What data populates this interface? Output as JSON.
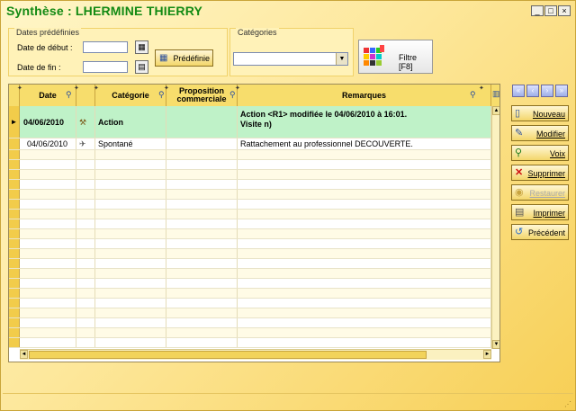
{
  "window": {
    "title": "Synthèse : LHERMINE THIERRY",
    "min_label": "_",
    "max_label": "□",
    "close_label": "×"
  },
  "dates": {
    "group_title": "Dates prédéfinies",
    "start_label": "Date de début :",
    "end_label": "Date de fin :",
    "start_value": "",
    "end_value": "",
    "predefined_label": "Prédéfinie"
  },
  "categories": {
    "group_title": "Catégories",
    "selected": ""
  },
  "filter": {
    "label": "Filtre [F8]"
  },
  "table": {
    "headers": {
      "date": "Date",
      "category": "Catégorie",
      "proposition_1": "Proposition",
      "proposition_2": "commerciale",
      "remarks": "Remarques"
    },
    "rows": [
      {
        "date": "04/06/2010",
        "category": "Action",
        "proposition": "",
        "remarks_1": "Action <R1> modifiée le 04/06/2010 à 16:01.",
        "remarks_2": "Visite n)",
        "icon": "hammer-icon"
      },
      {
        "date": "04/06/2010",
        "category": "Spontané",
        "proposition": "",
        "remarks_1": "Rattachement au professionnel DECOUVERTE.",
        "remarks_2": "",
        "icon": "bird-icon"
      }
    ]
  },
  "actions": {
    "new": "Nouveau",
    "edit": "Modifier",
    "view": "Voix",
    "delete": "Supprimer",
    "restore": "Restaurer",
    "print": "Imprimer",
    "previous": "Précédent"
  },
  "colors": {
    "title_green": "#138a13",
    "selected_row": "#bff2c8",
    "accent_yellow": "#f7dd6c"
  }
}
